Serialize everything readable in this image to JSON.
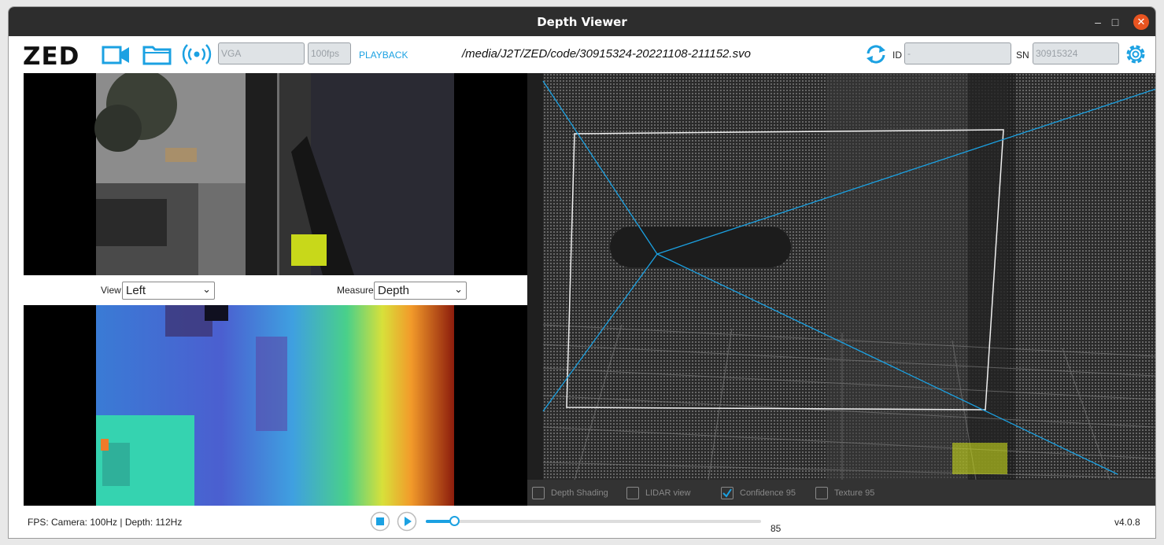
{
  "window": {
    "title": "Depth Viewer"
  },
  "toolbar": {
    "logo": "ZED",
    "resolution_value": "VGA",
    "fps_value": "100fps",
    "mode_label": "PLAYBACK",
    "file_path": "/media/J2T/ZED/code/30915324-20221108-211152.svo",
    "id_label": "ID",
    "id_value": "-",
    "sn_label": "SN",
    "sn_value": "30915324",
    "icons": [
      "camera-icon",
      "folder-icon",
      "stream-icon",
      "refresh-icon",
      "gear-icon"
    ]
  },
  "view_controls": {
    "view_label": "View",
    "view_value": "Left",
    "measure_label": "Measure",
    "measure_value": "Depth"
  },
  "point_cloud_options": [
    {
      "label": "Depth Shading",
      "checked": false
    },
    {
      "label": "LIDAR view",
      "checked": false
    },
    {
      "label": "Confidence 95",
      "checked": true
    },
    {
      "label": "Texture 95",
      "checked": false
    }
  ],
  "status": {
    "fps_text": "FPS: Camera: 100Hz | Depth: 112Hz",
    "frame": "85",
    "progress": 0.085,
    "version": "v4.0.8"
  },
  "colors": {
    "accent": "#1ba1e2",
    "titlebar": "#2d2d2d",
    "close": "#e95420"
  }
}
